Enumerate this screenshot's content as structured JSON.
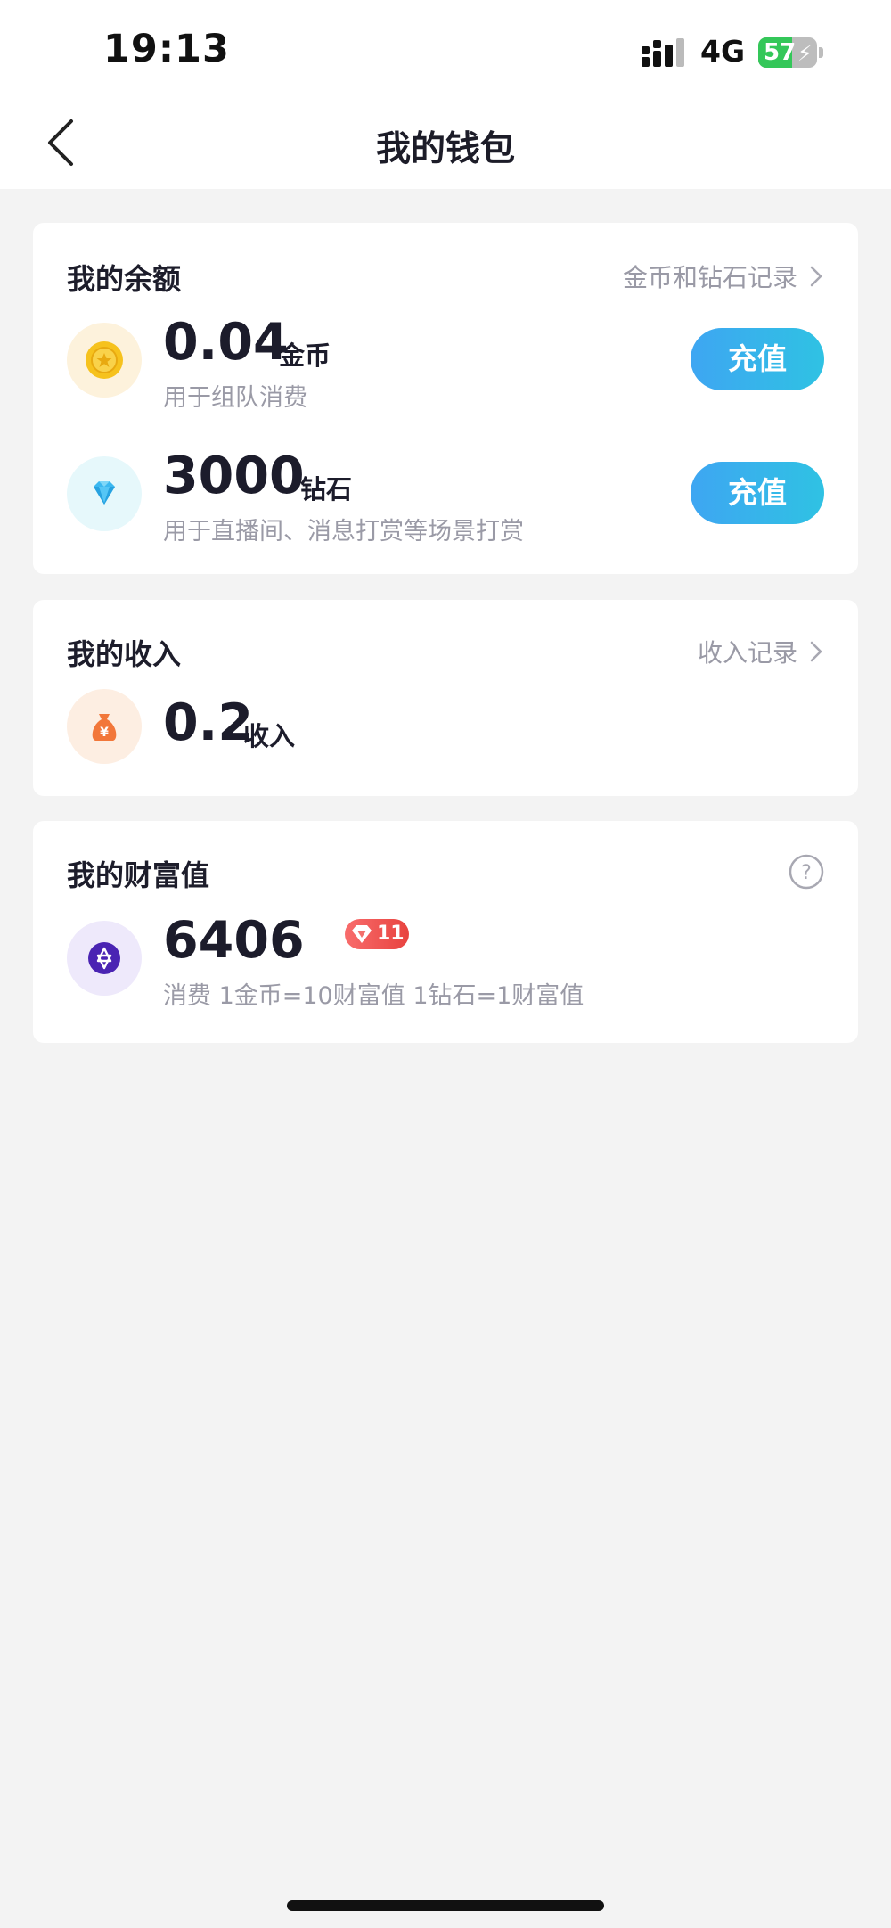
{
  "status_bar": {
    "time": "19:13",
    "network": "4G",
    "battery": "57",
    "battery_level": 0.57
  },
  "nav": {
    "title": "我的钱包"
  },
  "balance": {
    "title": "我的余额",
    "link": "金币和钻石记录",
    "coins": {
      "amount": "0.04",
      "unit": "金币",
      "desc": "用于组队消费",
      "button": "充值",
      "icon": "coin-icon"
    },
    "diamonds": {
      "amount": "3000",
      "unit": "钻石",
      "desc": "用于直播间、消息打赏等场景打赏",
      "button": "充值",
      "icon": "diamond-icon"
    }
  },
  "income": {
    "title": "我的收入",
    "link": "收入记录",
    "amount": "0.2",
    "unit": "收入",
    "icon": "money-bag-icon"
  },
  "wealth": {
    "title": "我的财富值",
    "amount": "6406",
    "level": "11",
    "desc": "消费 1金币=10财富值 1钻石=1财富值",
    "icon": "star-badge-icon"
  },
  "colors": {
    "accent_button_start": "#3ea6f2",
    "accent_button_end": "#2fc2e3",
    "level_badge": "#e8433f",
    "battery_green": "#34c759"
  }
}
